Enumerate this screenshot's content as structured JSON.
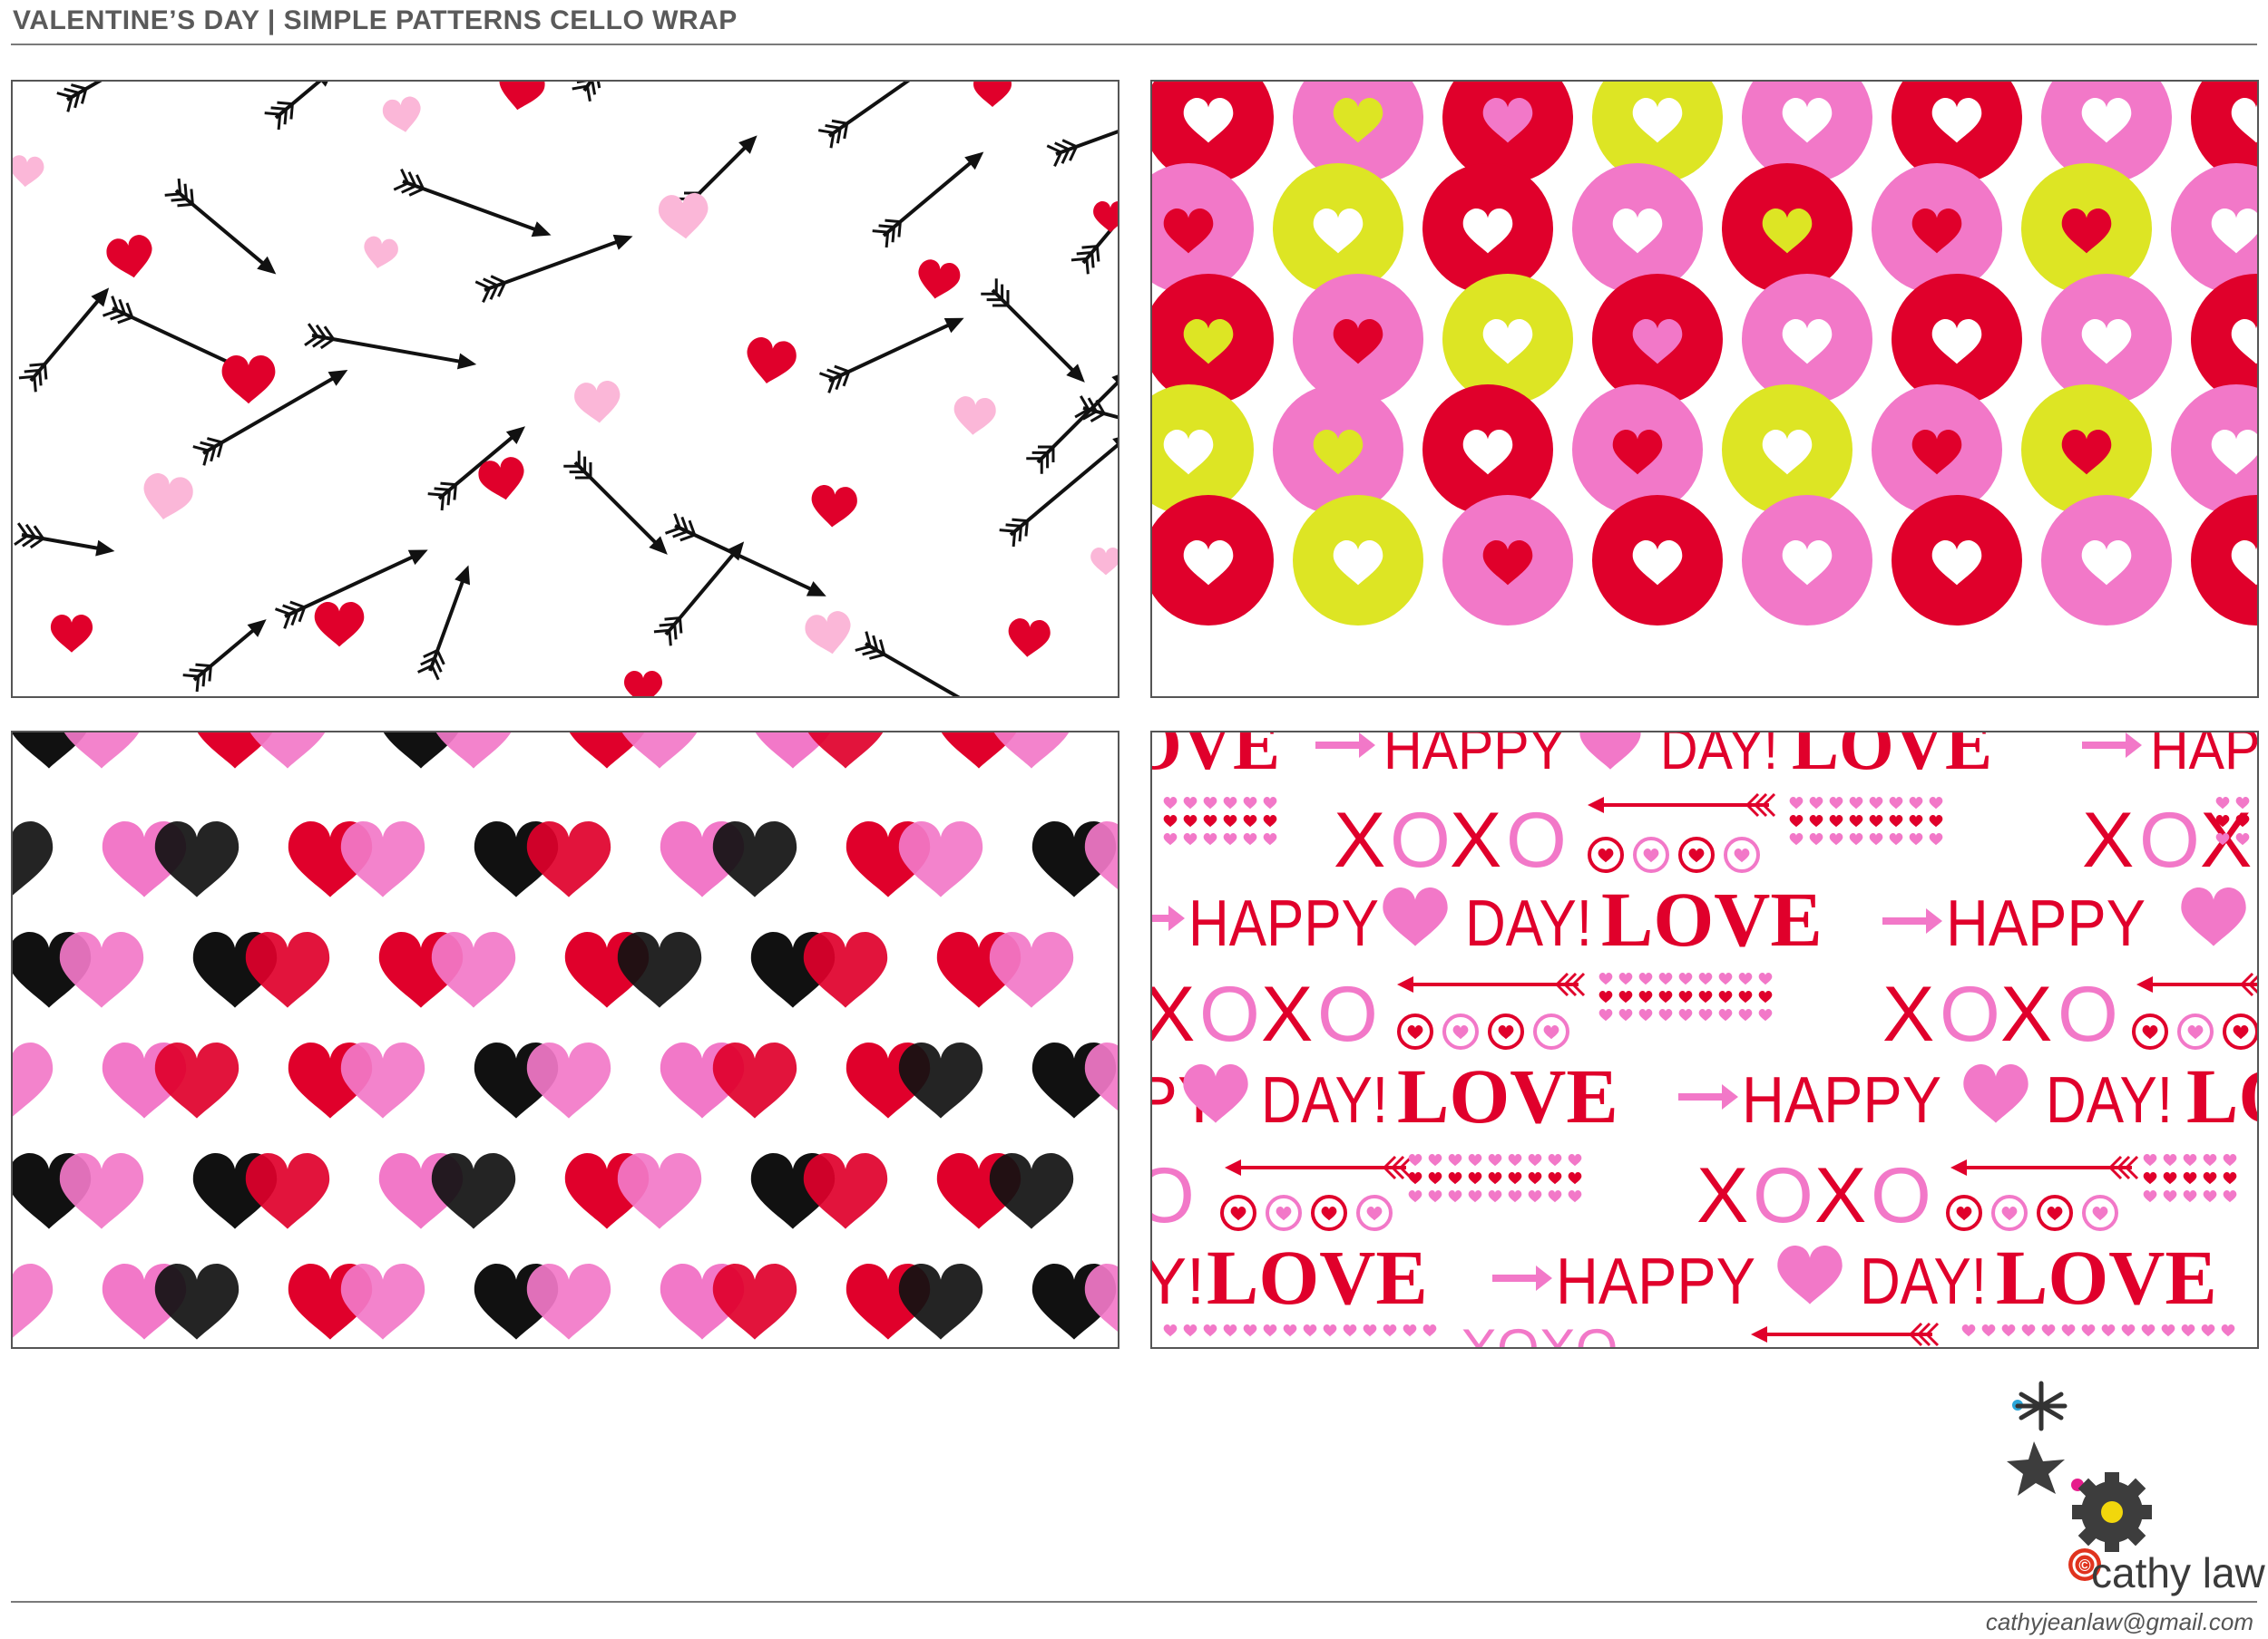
{
  "header": {
    "title": "VALENTINE’S DAY | SIMPLE PATTERNS CELLO WRAP"
  },
  "panels": [
    {
      "name": "arrows-and-hearts-pattern"
    },
    {
      "name": "heart-dots-pattern"
    },
    {
      "name": "overlapping-hearts-pattern"
    },
    {
      "name": "typography-pattern",
      "words": {
        "happy": "HAPPY",
        "day": "DAY!",
        "love": "LOVE",
        "xoxo": "XOXO"
      }
    }
  ],
  "footer": {
    "brand": "cathy law",
    "copyright": "©",
    "email": "cathyjeanlaw@gmail.com"
  },
  "colors": {
    "red": "#e0002b",
    "pink": "#f278c8",
    "lightPink": "#fbb7d8",
    "lime": "#dde524",
    "black": "#111111",
    "white": "#ffffff"
  }
}
